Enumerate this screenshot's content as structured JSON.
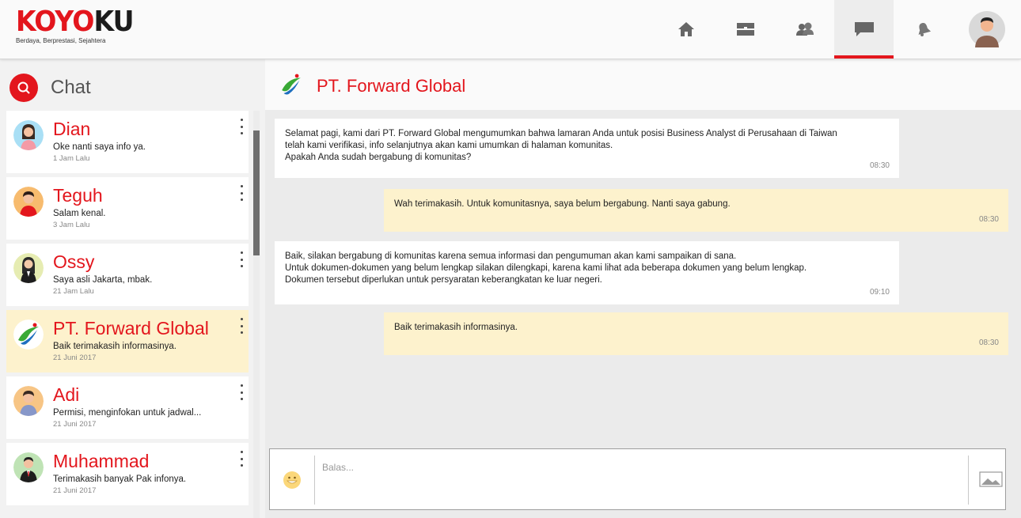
{
  "app": {
    "logo_part1": "KOYO",
    "logo_part2": "KU",
    "tagline": "Berdaya, Berprestasi, Sejahtera"
  },
  "nav": {
    "items": [
      {
        "icon": "home-icon",
        "active": false
      },
      {
        "icon": "jobs-icon",
        "active": false
      },
      {
        "icon": "community-icon",
        "active": false
      },
      {
        "icon": "chat-icon",
        "active": true
      },
      {
        "icon": "bell-icon",
        "active": false
      }
    ],
    "avatar_icon": "profile-avatar"
  },
  "sidebar": {
    "title": "Chat",
    "search_icon": "search-icon",
    "chats": [
      {
        "name": "Dian",
        "message": "Oke nanti saya info ya.",
        "time": "1 Jam Lalu",
        "active": false
      },
      {
        "name": "Teguh",
        "message": "Salam kenal.",
        "time": "3 Jam Lalu",
        "active": false
      },
      {
        "name": "Ossy",
        "message": "Saya asli Jakarta, mbak.",
        "time": "21 Jam Lalu",
        "active": false
      },
      {
        "name": "PT. Forward Global",
        "message": "Baik terimakasih informasinya.",
        "time": "21 Juni 2017",
        "active": true
      },
      {
        "name": "Adi",
        "message": "Permisi, menginfokan untuk jadwal...",
        "time": "21 Juni 2017",
        "active": false
      },
      {
        "name": "Muhammad",
        "message": "Terimakasih banyak Pak infonya.",
        "time": "21 Juni 2017",
        "active": false
      }
    ]
  },
  "conversation": {
    "name": "PT. Forward Global",
    "messages": [
      {
        "direction": "in",
        "text": "Selamat pagi, kami dari PT. Forward Global mengumumkan bahwa lamaran Anda untuk posisi Business Analyst di Perusahaan di Taiwan\ntelah kami verifikasi, info selanjutnya akan kami umumkan di halaman komunitas.\nApakah Anda sudah bergabung di komunitas?",
        "time": "08:30"
      },
      {
        "direction": "out",
        "text": "Wah terimakasih. Untuk komunitasnya, saya belum bergabung. Nanti saya gabung.",
        "time": "08:30"
      },
      {
        "direction": "in",
        "text": "Baik, silakan bergabung di komunitas karena semua informasi dan pengumuman akan kami sampaikan di sana.\nUntuk dokumen-dokumen yang belum lengkap silakan dilengkapi, karena kami lihat ada beberapa dokumen yang belum lengkap.\nDokumen tersebut diperlukan untuk persyaratan keberangkatan ke luar negeri.",
        "time": "09:10"
      },
      {
        "direction": "out",
        "text": "Baik terimakasih informasinya.",
        "time": "08:30"
      }
    ]
  },
  "reply": {
    "placeholder": "Balas...",
    "emoji_icon": "emoji-icon",
    "image_icon": "image-icon"
  },
  "colors": {
    "accent": "#e3161d",
    "outgoing_bubble": "#fdf2cd",
    "incoming_bubble": "#ffffff"
  }
}
